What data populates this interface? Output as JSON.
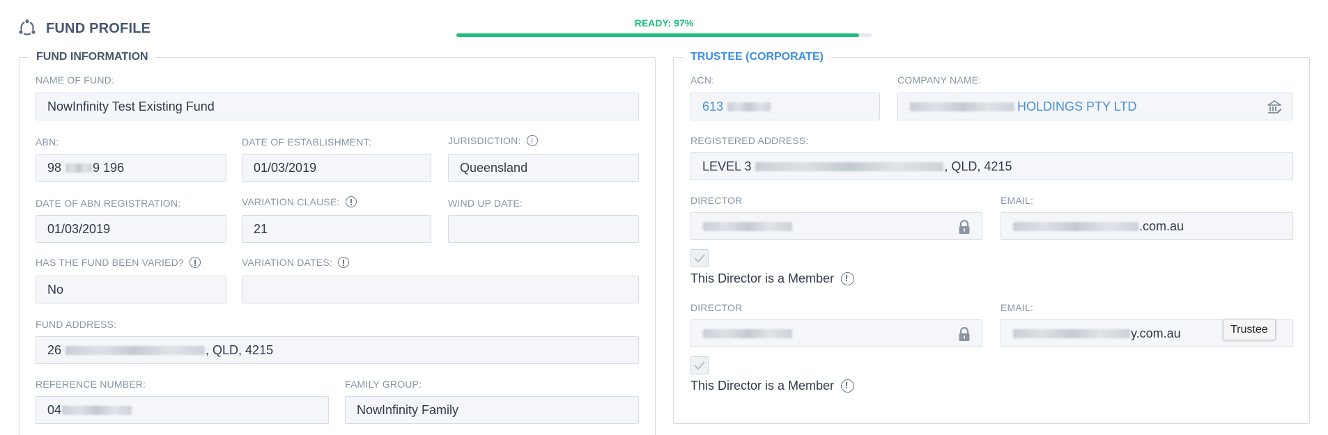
{
  "header": {
    "title": "FUND PROFILE",
    "icon": "cycle-icon",
    "ready_label": "READY: 97%",
    "progress_fraction": 0.97,
    "progress_color": "#1cc07a"
  },
  "fund_information": {
    "legend": "FUND INFORMATION",
    "name_of_fund": {
      "label": "NAME OF FUND:",
      "value": "NowInfinity Test Existing Fund"
    },
    "abn": {
      "label": "ABN:",
      "value_prefix": "98",
      "value_suffix": "9 196"
    },
    "date_of_establishment": {
      "label": "DATE OF ESTABLISHMENT:",
      "value": "01/03/2019"
    },
    "jurisdiction": {
      "label": "JURISDICTION:",
      "value": "Queensland"
    },
    "date_of_abn_registration": {
      "label": "DATE OF ABN REGISTRATION:",
      "value": "01/03/2019"
    },
    "variation_clause": {
      "label": "VARIATION CLAUSE:",
      "value": "21"
    },
    "wind_up_date": {
      "label": "WIND UP DATE:",
      "value": ""
    },
    "has_fund_been_varied": {
      "label": "HAS THE FUND BEEN VARIED?",
      "value": "No"
    },
    "variation_dates": {
      "label": "VARIATION DATES:",
      "value": ""
    },
    "fund_address": {
      "label": "FUND ADDRESS:",
      "value_prefix": "26",
      "value_suffix": ", QLD, 4215"
    },
    "reference_number": {
      "label": "REFERENCE NUMBER:",
      "value_prefix": "04"
    },
    "family_group": {
      "label": "FAMILY GROUP:",
      "value": "NowInfinity Family"
    }
  },
  "trustee": {
    "legend": "TRUSTEE (CORPORATE)",
    "acn": {
      "label": "ACN:",
      "value_prefix": "613"
    },
    "company_name": {
      "label": "COMPANY NAME:",
      "value_suffix": "HOLDINGS PTY LTD",
      "icon": "bank-icon"
    },
    "registered_address": {
      "label": "REGISTERED ADDRESS:",
      "value_prefix": "LEVEL 3",
      "value_suffix": ", QLD, 4215"
    },
    "directors": [
      {
        "director_label": "DIRECTOR",
        "email_label": "EMAIL:",
        "email_suffix": ".com.au",
        "lock_icon": "lock-icon",
        "member_text": "This Director is a Member"
      },
      {
        "director_label": "DIRECTOR",
        "email_label": "EMAIL:",
        "email_suffix": "y.com.au",
        "lock_icon": "lock-icon",
        "member_text": "This Director is a Member"
      }
    ]
  },
  "tooltip": {
    "text": "Trustee"
  }
}
